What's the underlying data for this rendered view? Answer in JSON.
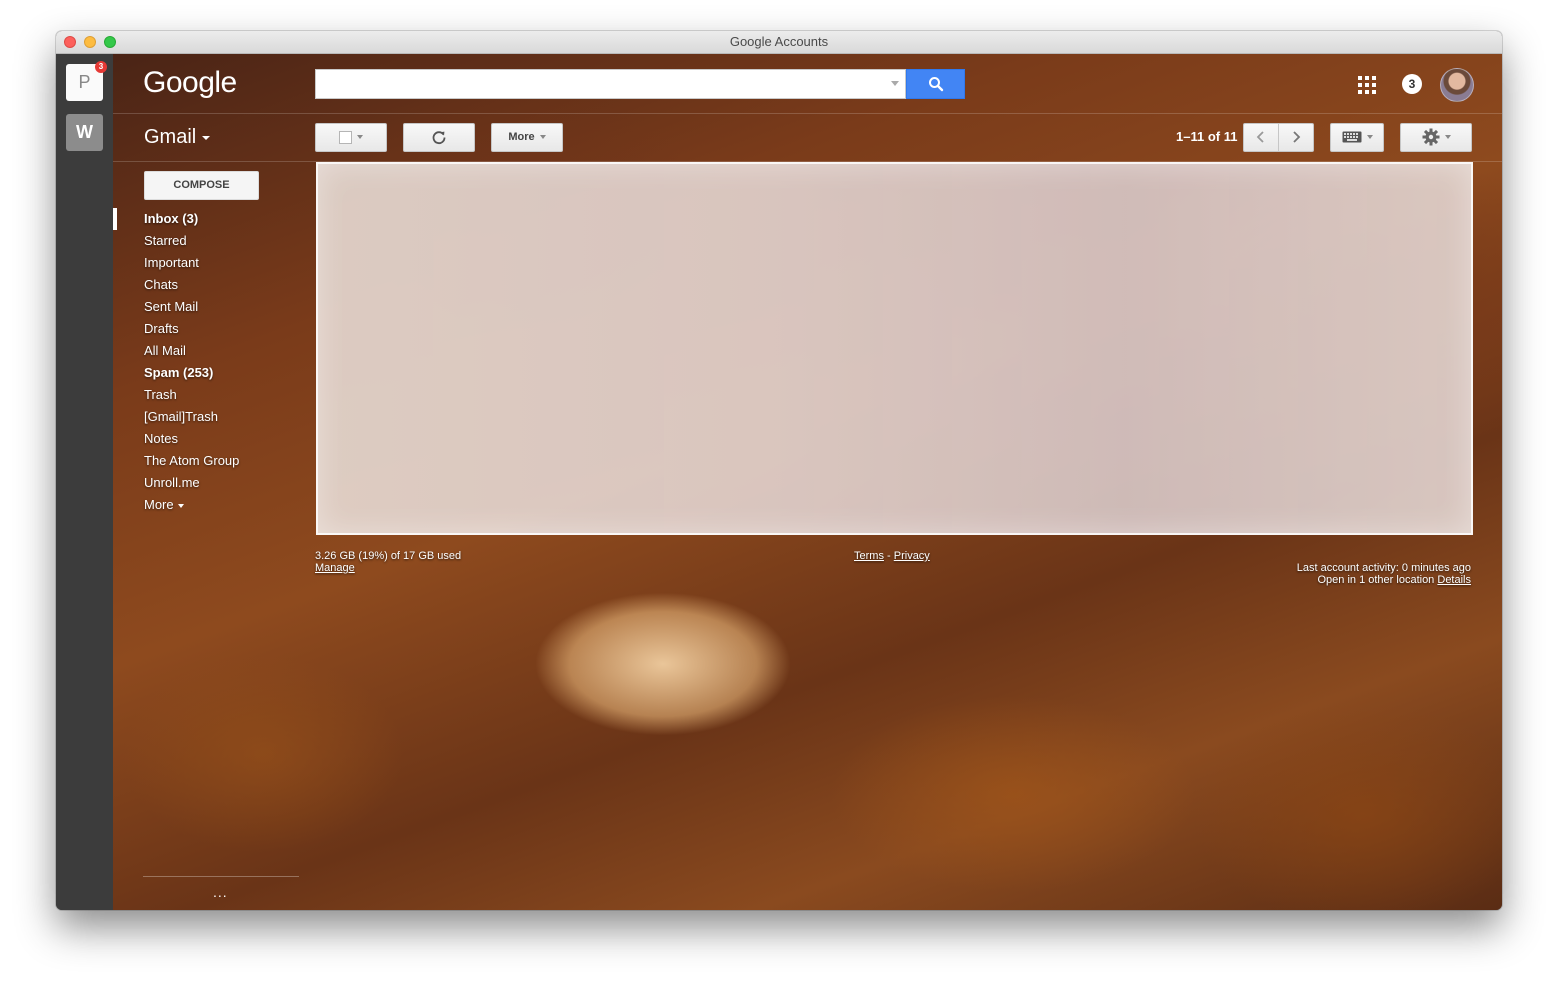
{
  "window": {
    "title": "Google Accounts"
  },
  "accounts": [
    {
      "letter": "P",
      "badge": "3"
    },
    {
      "letter": "W"
    }
  ],
  "header": {
    "logo": "Google",
    "search_value": "",
    "notifications": "3"
  },
  "toolbar": {
    "app_label": "Gmail",
    "more_label": "More",
    "pager": "1–11 of 11"
  },
  "compose_label": "COMPOSE",
  "nav": {
    "items": [
      {
        "label": "Inbox (3)",
        "bold": true,
        "active": true
      },
      {
        "label": "Starred"
      },
      {
        "label": "Important"
      },
      {
        "label": "Chats"
      },
      {
        "label": "Sent Mail"
      },
      {
        "label": "Drafts"
      },
      {
        "label": "All Mail"
      },
      {
        "label": "Spam (253)",
        "bold": true
      },
      {
        "label": "Trash"
      },
      {
        "label": "[Gmail]Trash"
      },
      {
        "label": "Notes"
      },
      {
        "label": "The Atom Group"
      },
      {
        "label": "Unroll.me"
      },
      {
        "label": "More"
      }
    ],
    "footer_dots": "..."
  },
  "footer": {
    "storage": "3.26 GB (19%) of 17 GB used",
    "manage": "Manage",
    "terms": "Terms",
    "separator": "-",
    "privacy": "Privacy",
    "activity": "Last account activity: 0 minutes ago",
    "open_other": "Open in 1 other location",
    "details": "Details"
  },
  "colors": {
    "search_button": "#4285f4",
    "badge": "#e53935"
  }
}
